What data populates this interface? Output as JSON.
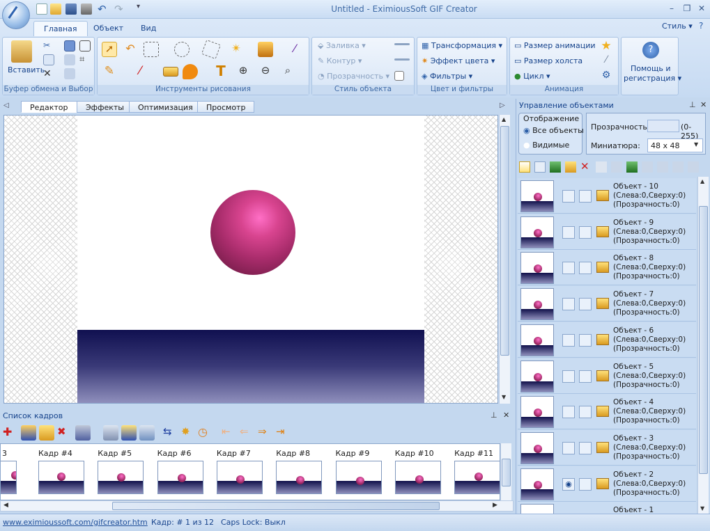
{
  "app": {
    "title": "Untitled - EximiousSoft GIF Creator",
    "style_menu": "Стиль"
  },
  "ribbon": {
    "tabs": [
      "Главная",
      "Объект",
      "Вид"
    ],
    "clipboard": {
      "paste": "Вставить",
      "group": "Буфер обмена и Выбор"
    },
    "draw": {
      "group": "Инструменты рисования"
    },
    "objstyle": {
      "fill": "Заливка",
      "outline": "Контур",
      "transparency": "Прозрачность",
      "group": "Стиль объекта"
    },
    "color": {
      "transform": "Трансформация",
      "color_effect": "Эффект цвета",
      "filters": "Фильтры",
      "group": "Цвет и фильтры"
    },
    "anim": {
      "anim_size": "Размер анимации",
      "canvas_size": "Размер холста",
      "loop": "Цикл",
      "group": "Анимация"
    },
    "help": {
      "line1": "Помощь и",
      "line2": "регистрация"
    }
  },
  "doc_tabs": [
    "Редактор",
    "Эффекты",
    "Оптимизация",
    "Просмотр"
  ],
  "frames_panel": {
    "title": "Список кадров",
    "first_label": "3",
    "frames": [
      "Кадр #4",
      "Кадр #5",
      "Кадр #6",
      "Кадр #7",
      "Кадр #8",
      "Кадр #9",
      "Кадр #10",
      "Кадр #11"
    ]
  },
  "objects_panel": {
    "title": "Управление объектами",
    "display_group": "Отображение",
    "radio_all": "Все объекты",
    "radio_visible": "Видимые",
    "transparency_label": "Прозрачность:",
    "transparency_range": "(0-255)",
    "thumb_label": "Миниатюра:",
    "thumb_value": "48 x 48",
    "objects": [
      {
        "name": "Объект - 10",
        "pos": "(Слева:0,Сверху:0)",
        "alpha": "(Прозрачность:0)"
      },
      {
        "name": "Объект - 9",
        "pos": "(Слева:0,Сверху:0)",
        "alpha": "(Прозрачность:0)"
      },
      {
        "name": "Объект - 8",
        "pos": "(Слева:0,Сверху:0)",
        "alpha": "(Прозрачность:0)"
      },
      {
        "name": "Объект - 7",
        "pos": "(Слева:0,Сверху:0)",
        "alpha": "(Прозрачность:0)"
      },
      {
        "name": "Объект - 6",
        "pos": "(Слева:0,Сверху:0)",
        "alpha": "(Прозрачность:0)"
      },
      {
        "name": "Объект - 5",
        "pos": "(Слева:0,Сверху:0)",
        "alpha": "(Прозрачность:0)"
      },
      {
        "name": "Объект - 4",
        "pos": "(Слева:0,Сверху:0)",
        "alpha": "(Прозрачность:0)"
      },
      {
        "name": "Объект - 3",
        "pos": "(Слева:0,Сверху:0)",
        "alpha": "(Прозрачность:0)"
      },
      {
        "name": "Объект - 2",
        "pos": "(Слева:0,Сверху:0)",
        "alpha": "(Прозрачность:0)"
      },
      {
        "name": "Объект - 1",
        "pos": "",
        "alpha": ""
      }
    ]
  },
  "status": {
    "url": "www.eximioussoft.com/gifcreator.htm",
    "frame": "Кадр: # 1 из 12",
    "caps": "Caps Lock: Выкл"
  }
}
